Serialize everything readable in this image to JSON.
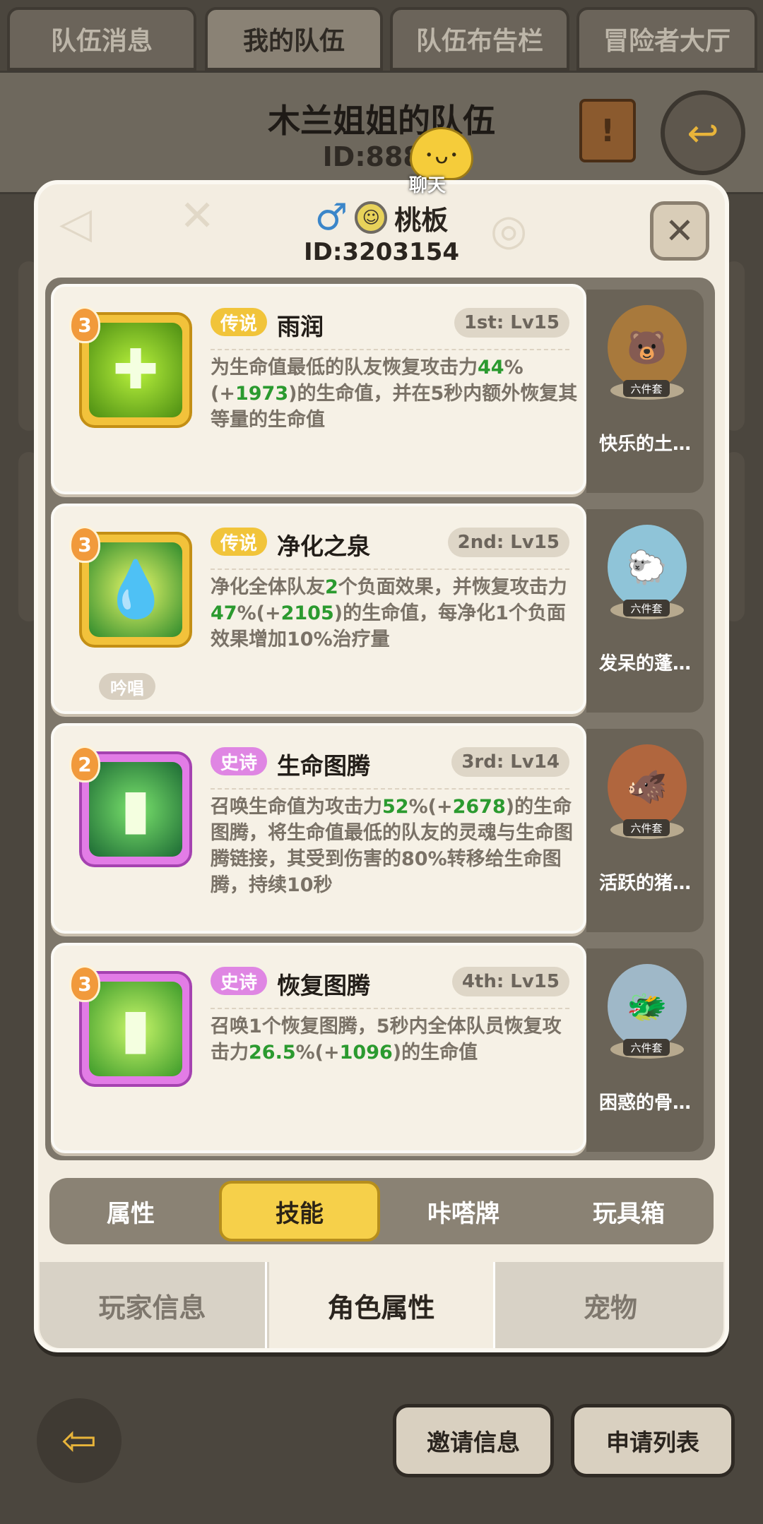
{
  "top_tabs": [
    "队伍消息",
    "我的队伍",
    "队伍布告栏",
    "冒险者大厅"
  ],
  "team": {
    "title": "木兰姐姐的队伍",
    "id_prefix": "ID:8886"
  },
  "chat": {
    "label": "聊天"
  },
  "player": {
    "gender_icon": "male-icon",
    "name": "桃板",
    "id": "ID:3203154"
  },
  "skills": [
    {
      "level_badge": "3",
      "rarity": "传说",
      "name": "雨润",
      "slot": "1st: Lv15",
      "desc": [
        "为生命值最低的队友恢复攻击力",
        "44",
        "%(+",
        "1973",
        ")的生命值，并在5秒内额外恢复其等量的生命值"
      ],
      "pet": {
        "name": "快乐的土…",
        "set": "六件套"
      }
    },
    {
      "level_badge": "3",
      "rarity": "传说",
      "name": "净化之泉",
      "slot": "2nd: Lv15",
      "chant": "吟唱",
      "desc": [
        "净化全体队友",
        "2",
        "个负面效果，并恢复攻击力",
        "47",
        "%(+",
        "2105",
        ")的生命值，每净化1个负面效果增加10%治疗量"
      ],
      "pet": {
        "name": "发呆的蓬…",
        "set": "六件套"
      }
    },
    {
      "level_badge": "2",
      "rarity": "史诗",
      "name": "生命图腾",
      "slot": "3rd: Lv14",
      "desc": [
        "召唤生命值为攻击力",
        "52",
        "%(+",
        "2678",
        ")的生命图腾，将生命值最低的队友的灵魂与生命图腾链接，其受到伤害的80%转移给生命图腾，持续10秒"
      ],
      "pet": {
        "name": "活跃的猪…",
        "set": "六件套"
      }
    },
    {
      "level_badge": "3",
      "rarity": "史诗",
      "name": "恢复图腾",
      "slot": "4th: Lv15",
      "desc": [
        "召唤1个恢复图腾，5秒内全体队员恢复攻击力",
        "26.5",
        "%(+",
        "1096",
        ")的生命值"
      ],
      "pet": {
        "name": "困惑的骨…",
        "set": "六件套"
      }
    }
  ],
  "sub_tabs": [
    "属性",
    "技能",
    "咔嗒牌",
    "玩具箱"
  ],
  "bottom_tabs": [
    "玩家信息",
    "角色属性",
    "宠物"
  ],
  "footer": {
    "invite": "邀请信息",
    "apply": "申请列表"
  },
  "colors": {
    "legend": "#f1c43a",
    "epic": "#df86e3",
    "highlight_green": "#2b9a2f",
    "active_tab": "#f6d04a"
  }
}
